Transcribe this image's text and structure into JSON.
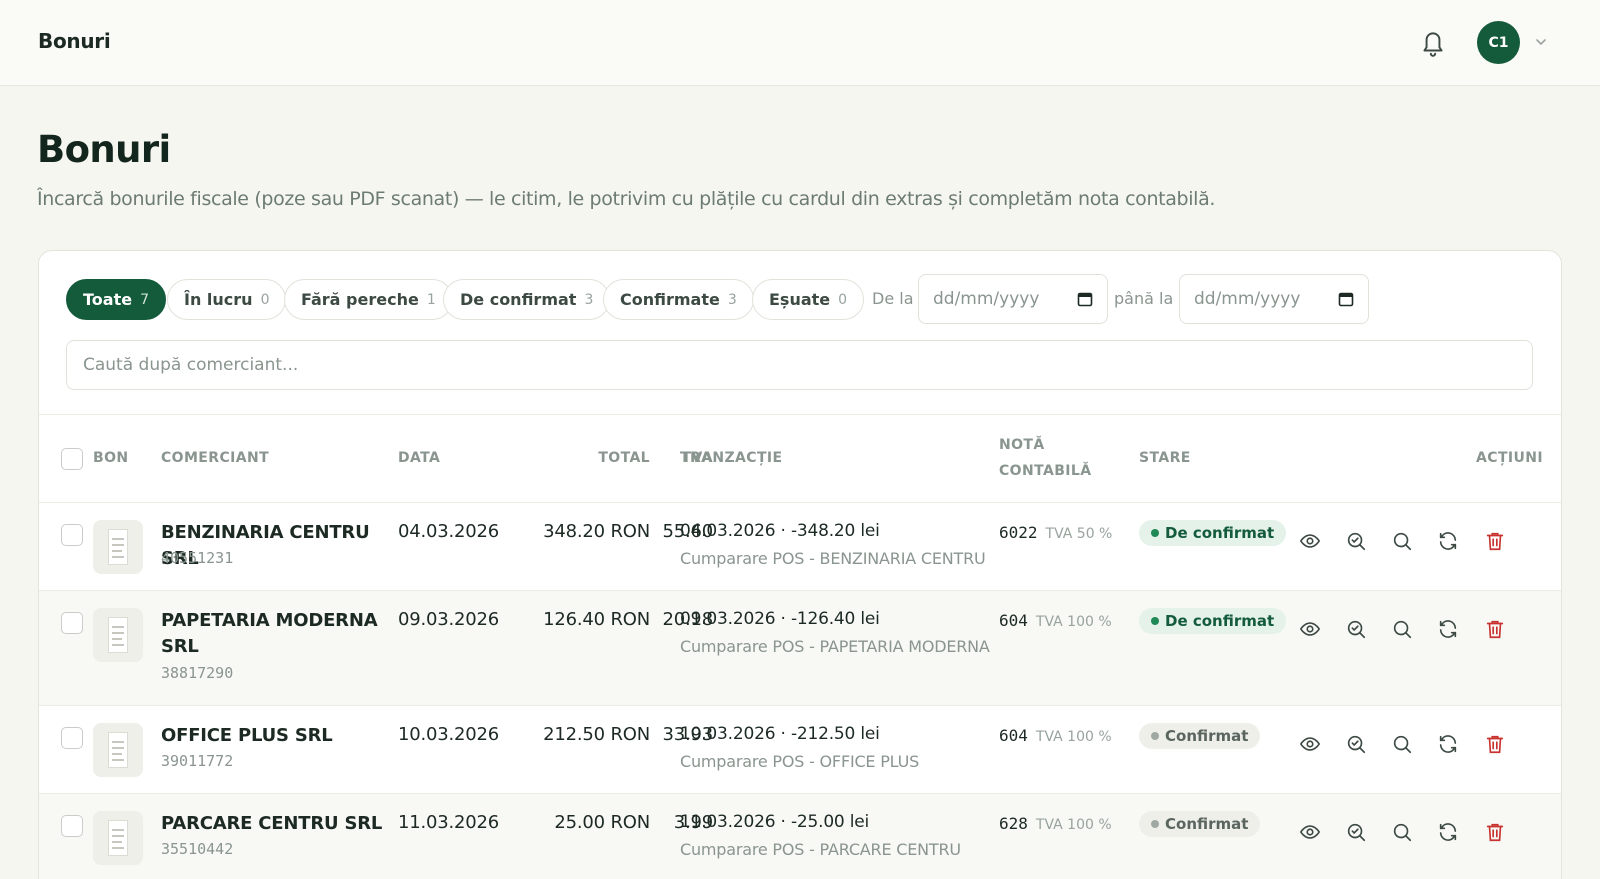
{
  "topbar": {
    "title": "Bonuri",
    "avatar_initials": "C1"
  },
  "header": {
    "title": "Bonuri",
    "subtitle": "Încarcă bonurile fiscale (poze sau PDF scanat) — le citim, le potrivim cu plățile cu cardul din extras și completăm nota contabilă."
  },
  "filters": {
    "chips": [
      {
        "label": "Toate",
        "count": "7",
        "active": true
      },
      {
        "label": "În lucru",
        "count": "0"
      },
      {
        "label": "Fără pereche",
        "count": "1"
      },
      {
        "label": "De confirmat",
        "count": "3"
      },
      {
        "label": "Confirmate",
        "count": "3"
      },
      {
        "label": "Eșuate",
        "count": "0"
      }
    ],
    "from_label": "De la",
    "to_label": "până la",
    "date_placeholder": "dd/mm/yyyy"
  },
  "search": {
    "placeholder": "Caută după comerciant..."
  },
  "table": {
    "columns": {
      "bon": "BON",
      "merchant": "COMERCIANT",
      "date": "DATA",
      "total": "TOTAL",
      "vat": "TVA",
      "transaction": "TRANZACȚIE",
      "note_1": "NOTĂ",
      "note_2": "CONTABILĂ",
      "status": "STARE",
      "actions": "ACȚIUNI"
    },
    "rows": [
      {
        "merchant": "BENZINARIA CENTRU SRL",
        "cui": "40551231",
        "date": "04.03.2026",
        "total": "348.20 RON",
        "vat": "55.60",
        "tx_main": "04.03.2026 · -348.20 lei",
        "tx_desc": "Cumparare POS - BENZINARIA CENTRU",
        "account": "6022",
        "account_vat": "TVA 50 %",
        "status": "De confirmat"
      },
      {
        "merchant": "PAPETARIA MODERNA SRL",
        "cui": "38817290",
        "date": "09.03.2026",
        "total": "126.40 RON",
        "vat": "20.18",
        "tx_main": "09.03.2026 · -126.40 lei",
        "tx_desc": "Cumparare POS - PAPETARIA MODERNA",
        "account": "604",
        "account_vat": "TVA 100 %",
        "status": "De confirmat"
      },
      {
        "merchant": "OFFICE PLUS SRL",
        "cui": "39011772",
        "date": "10.03.2026",
        "total": "212.50 RON",
        "vat": "33.93",
        "tx_main": "10.03.2026 · -212.50 lei",
        "tx_desc": "Cumparare POS - OFFICE PLUS",
        "account": "604",
        "account_vat": "TVA 100 %",
        "status": "Confirmat"
      },
      {
        "merchant": "PARCARE CENTRU SRL",
        "cui": "35510442",
        "date": "11.03.2026",
        "total": "25.00 RON",
        "vat": "3.99",
        "tx_main": "11.03.2026 · -25.00 lei",
        "tx_desc": "Cumparare POS - PARCARE CENTRU",
        "account": "628",
        "account_vat": "TVA 100 %",
        "status": "Confirmat"
      }
    ]
  },
  "actions": [
    "eye-icon",
    "zoom-check-icon",
    "search-icon",
    "refresh-icon",
    "trash-icon"
  ],
  "colors": {
    "brand": "#135b3b",
    "danger": "#c8322f",
    "background": "#f6f6f1"
  }
}
